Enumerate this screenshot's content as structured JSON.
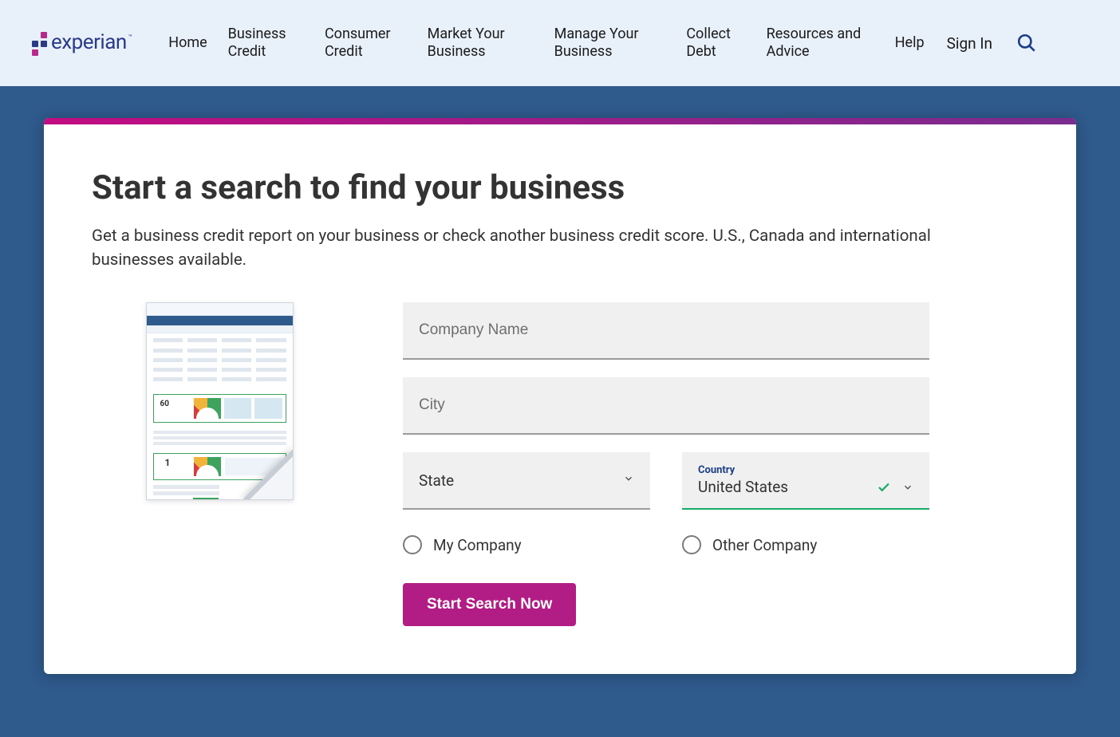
{
  "brand": {
    "name": "experian"
  },
  "nav": {
    "items": [
      "Home",
      "Business Credit",
      "Consumer Credit",
      "Market Your Business",
      "Manage Your Business",
      "Collect Debt",
      "Resources and Advice",
      "Help"
    ],
    "signin": "Sign In"
  },
  "main": {
    "heading": "Start a search to find your business",
    "subheading": "Get a business credit report on your business or check another business credit score. U.S., Canada and international businesses available."
  },
  "form": {
    "company_placeholder": "Company Name",
    "city_placeholder": "City",
    "state_label": "State",
    "country_mini_label": "Country",
    "country_value": "United States",
    "radio_my": "My Company",
    "radio_other": "Other Company",
    "submit_label": "Start Search Now"
  }
}
